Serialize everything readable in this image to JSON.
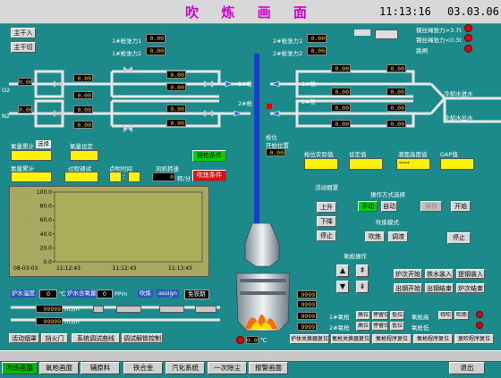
{
  "header": {
    "title": "吹 炼 画 面",
    "time": "11:13:16",
    "date": "03.03.06"
  },
  "left_buttons": {
    "main_in": "主干入",
    "main_cut": "主干切"
  },
  "lance_left": {
    "lance1_label": "1#枪张力1",
    "lance1_value": "0.00",
    "lance2_label": "1#枪张力2",
    "lance2_value": "0.00"
  },
  "lance_right": {
    "lance1_label": "2#枪张力1",
    "lance1_value": "0.00",
    "lance2_label": "2#枪张力2",
    "lance2_value": "0.00"
  },
  "alarms": [
    {
      "label": "钢丝绳张力>3.7t"
    },
    {
      "label": "钢丝绳张力<0.3t"
    },
    {
      "label": "跳闸"
    }
  ],
  "lines": {
    "o2": "O2",
    "n2": "N2",
    "gun1": "1#枪",
    "gun2": "2#枪",
    "gun1_right": "1#枪",
    "gun2_right": "2#枪",
    "cw_in": "冷却水进水",
    "cw_out": "冷却水出水"
  },
  "pipe_values": {
    "pressure": "0.00"
  },
  "stats": {
    "o2_total_label": "氧量累计",
    "o2_total_badge": "选择",
    "o2_set_label": "氧量设定",
    "n2_total_label": "氮量累计",
    "proc_label": "过程调试",
    "point_time_label": "点吹时间",
    "gun_speed_label": "风机转速",
    "time_sep": ":",
    "speed_value": "0",
    "speed_unit": "转/分",
    "burn_cond": "摆枪条件",
    "blow_cond": "吹炼条件"
  },
  "chart_data": {
    "type": "line",
    "yticks": [
      "100.0",
      "80.0",
      "60.0",
      "40.0",
      "20.0",
      "0.0"
    ],
    "xticks": [
      "11:12:43",
      "11:12:43",
      "11:13:43"
    ],
    "x_prefix": "08-03-03",
    "ylim": [
      0,
      100
    ]
  },
  "chart_bottom": {
    "oxy_temp_label": "炉水温度",
    "oxy_temp_value": "0",
    "oxy_temp_unit": "℃",
    "oxy_content_label": "炉水含氧量",
    "oxy_content_value": "0",
    "oxy_content_unit": "PPm",
    "dust": "吹炼",
    "assign": "assign",
    "refill": "免铁期"
  },
  "flow_rows": [
    {
      "value": "99999",
      "unit": "m3/h"
    },
    {
      "value": "99999",
      "unit": "m3/h"
    }
  ],
  "bottom_left_buttons": [
    "活动烟罩",
    "挡火门",
    "系统调试曲线",
    "调试解锁控制"
  ],
  "center": {
    "lance_pos_label": "枪位",
    "lance_pos_label2": "开始位置",
    "lance_pos_value": "0.00",
    "bottom_value": "0.00",
    "unit": "℃"
  },
  "right_top": {
    "actual_label": "枪位实际值",
    "set_label": "设定值",
    "deflect_label": "液面高度值",
    "gap_label": "GAP值",
    "gap_value": "****"
  },
  "mode": {
    "activity_label": "活动烟罩",
    "up": "上升",
    "down": "下降",
    "stop": "停止",
    "op_mode_label": "操作方式选择",
    "manual": "手动",
    "auto": "自动",
    "hold": "保持",
    "start": "开始",
    "blow_mode_label": "吹炼模式",
    "blow": "吹炼",
    "refine": "调渣",
    "stop2": "停止"
  },
  "lance_op": {
    "label": "氧枪操作",
    "furnace_start": "炉次开始",
    "iron_in": "铁水装入",
    "lance_step": "提钢装入",
    "tap_start": "出钢开始",
    "tap_end": "出钢结束",
    "furnace_end": "炉次结束"
  },
  "lance_status": {
    "gun1": "1#氧枪",
    "gun2": "2#氧枪",
    "items": [
      "高位",
      "停留位",
      "低位",
      "待吹",
      "吹炼",
      "氧枪高",
      "氧枪低"
    ]
  },
  "right_values": [
    "9999",
    "9999",
    "9999",
    "9999"
  ],
  "reset_buttons": [
    "炉体关换器复位",
    "氧枪关换器复位",
    "氧枪程序复位",
    "氧枪程序复位",
    "复吹程序复位"
  ],
  "nav": [
    "吹炼画面",
    "氧枪画面",
    "辅原料",
    "铁合金",
    "汽化系统",
    "一次除尘",
    "报警画面",
    "退出"
  ]
}
